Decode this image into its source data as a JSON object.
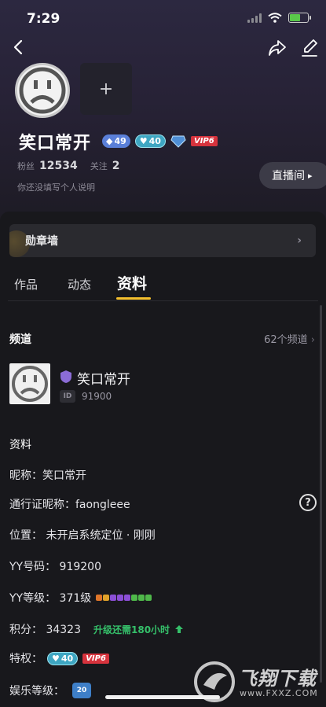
{
  "status_bar": {
    "time": "7:29"
  },
  "profile": {
    "add_photo_label": "+",
    "name": "笑口常开",
    "badges": {
      "level_a": "49",
      "level_b": "40",
      "vip": "VIP6"
    },
    "stats": {
      "fans_label": "粉丝",
      "fans_value": "12534",
      "following_label": "关注",
      "following_value": "2"
    },
    "bio": "你还没填写个人说明",
    "live_button_label": "直播间",
    "live_button_arrow": "▸"
  },
  "medal_wall": {
    "label": "勋章墙",
    "chevron": "›"
  },
  "tabs": [
    {
      "label": "作品"
    },
    {
      "label": "动态"
    },
    {
      "label": "资料"
    }
  ],
  "channel": {
    "heading": "频道",
    "count": "62个频道",
    "chevron": "›",
    "name": "笑口常开",
    "id_tag": "ID",
    "id_value": "91900"
  },
  "info": {
    "heading": "资料",
    "nickname": "昵称：笑口常开",
    "passport_nickname": "通行证昵称：faongleee",
    "help_icon": "?",
    "location": "位置：  未开启系统定位 · 刚刚",
    "yy_number": "YY号码：  919200",
    "yy_level": "YY等级：  371级",
    "points": "积分：  34323",
    "points_hint": "升级还需180小时",
    "privileges_label": "特权：",
    "privilege_level": "40",
    "privilege_vip": "VIP6",
    "entertainment_label": "娱乐等级：",
    "entertainment_level": "20"
  },
  "watermark": {
    "text": "飞翔下载",
    "site": "www.FXXZ.COM"
  },
  "colors": {
    "accent": "#f5c02e",
    "vip_red": "#d6333d",
    "badge_blue": "#5a7fd8",
    "badge_teal": "#3ea6c2",
    "hint_green": "#35c06a"
  }
}
